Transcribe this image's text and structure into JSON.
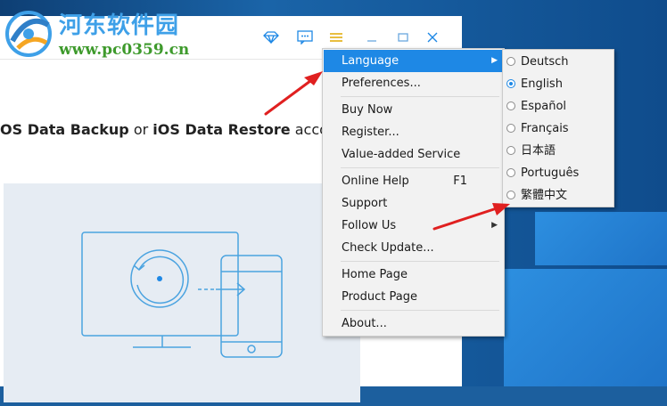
{
  "watermark": {
    "site_name": "河东软件园",
    "url": "www.pc0359.cn"
  },
  "toolbar": {
    "icons": [
      "diamond-icon",
      "feedback-icon",
      "menu-icon",
      "minimize-icon",
      "maximize-icon",
      "close-icon"
    ]
  },
  "main": {
    "intro_prefix": "OS Data Backup",
    "intro_or": " or ",
    "intro_bold2": "iOS Data Restore",
    "intro_suffix": " accordi"
  },
  "menu": {
    "items": [
      {
        "label": "Language",
        "submenu": true,
        "highlighted": true
      },
      {
        "label": "Preferences..."
      },
      {
        "label": "Buy Now"
      },
      {
        "label": "Register..."
      },
      {
        "label": "Value-added Service"
      },
      {
        "label": "Online Help",
        "shortcut": "F1"
      },
      {
        "label": "Support"
      },
      {
        "label": "Follow Us",
        "submenu": true
      },
      {
        "label": "Check Update..."
      },
      {
        "label": "Home Page"
      },
      {
        "label": "Product Page"
      },
      {
        "label": "About..."
      }
    ]
  },
  "language_menu": {
    "selected": "English",
    "options": [
      "Deutsch",
      "English",
      "Español",
      "Français",
      "日本語",
      "Português",
      "繁體中文"
    ]
  },
  "colors": {
    "highlight": "#1e88e5",
    "annotation_arrow": "#e02020"
  }
}
